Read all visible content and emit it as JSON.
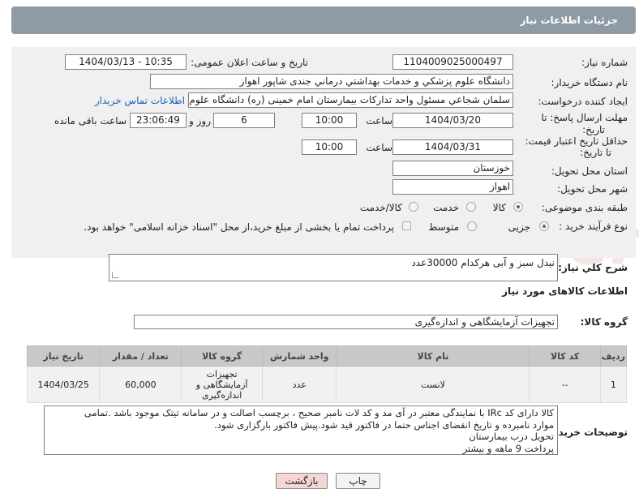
{
  "header": {
    "title": "جزئیات اطلاعات نیاز"
  },
  "form": {
    "need_number_label": "شماره نیاز:",
    "need_number": "1104009025000497",
    "announce_label": "تاریخ و ساعت اعلان عمومی:",
    "announce_value": "1404/03/13 - 10:35",
    "buyer_org_label": "نام دستگاه خریدار:",
    "buyer_org": "دانشگاه علوم پزشكي و خدمات بهداشتي درماني جندی شاپور اهواز",
    "creator_label": "ایجاد کننده درخواست:",
    "creator": "سلمان شجاعي مسئول واحد تدارکات بیمارستان امام خمینی (ره) دانشگاه علوم",
    "contact_link": "اطلاعات تماس خریدار",
    "deadline_label_1": "مهلت ارسال پاسخ: تا",
    "deadline_label_2": "تاریخ:",
    "deadline_date": "1404/03/20",
    "time_label": "ساعت",
    "deadline_time": "10:00",
    "days_value": "6",
    "days_label": "روز و",
    "remaining_value": "23:06:49",
    "remaining_label": "ساعت باقی مانده",
    "validity_label_1": "حداقل تاریخ اعتبار قیمت:",
    "validity_label_2": "تا تاریخ:",
    "validity_date": "1404/03/31",
    "validity_time": "10:00",
    "province_label": "استان محل تحویل:",
    "province": "خوزستان",
    "city_label": "شهر محل تحویل:",
    "city": "اهواز",
    "category_label": "طبقه بندی موضوعی:",
    "category_options": [
      "کالا",
      "خدمت",
      "کالا/خدمت"
    ],
    "process_label": "نوع فرآیند خرید :",
    "process_options": [
      "جزیی",
      "متوسط"
    ],
    "payment_note": "پرداخت تمام یا بخشی از مبلغ خرید،از محل \"اسناد خزانه اسلامی\" خواهد بود."
  },
  "summary": {
    "label": "شرح کلي نياز:",
    "value": "نیدل سبز و آبی هرکدام 30000عدد"
  },
  "goods_section": {
    "title": "اطلاعات کالاهای مورد نیاز",
    "group_label": "گروه کالا:",
    "group_value": "تجهیزات آزمایشگاهی و اندازه‌گیری"
  },
  "table": {
    "headers": [
      "ردیف",
      "کد کالا",
      "نام کالا",
      "واحد شمارش",
      "گروه کالا",
      "تعداد / مقدار",
      "تاریخ نیاز"
    ],
    "rows": [
      {
        "index": "1",
        "code": "--",
        "name": "لانست",
        "unit": "عدد",
        "group": "تجهیزات آزمایشگاهی و اندازه‌گیری",
        "qty": "60,000",
        "date": "1404/03/25"
      }
    ]
  },
  "buyer_notes": {
    "label": "توضیحات خریدار:",
    "lines": [
      "کالا دارای کد IRc با نمایندگی معتبر در آی مد و کد لات نامبر صحیح ، برچسب اصالت و در سامانه تیتک موجود باشد .تمامی",
      "موارد نامبرده و تاریخ انقضای اجناس حتما در فاکتور قید شود.پیش فاکتور بارگزاری شود.",
      "تحویل درب بیمارستان",
      "پرداخت 9 ماهه و بیشتر"
    ]
  },
  "buttons": {
    "print": "چاپ",
    "back": "بازگشت"
  },
  "colors": {
    "header_bg": "#8e9aa4",
    "panel_bg": "#f0f0f0",
    "link": "#1a5fb4",
    "back_btn_bg": "#f6d5d5"
  }
}
